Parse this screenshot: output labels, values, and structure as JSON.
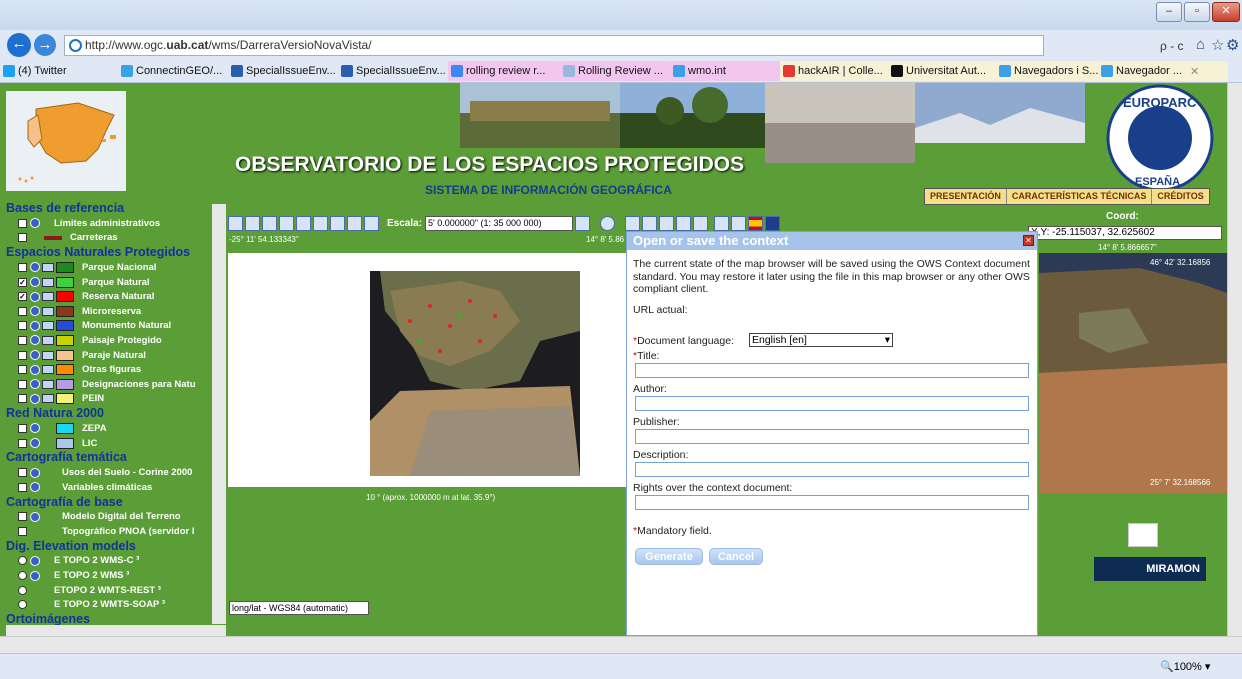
{
  "browser": {
    "url_prefix": "http://www.ogc.",
    "url_domain": "uab.cat",
    "url_path": "/wms/DarreraVersioNovaVista/",
    "search_label": "ρ - c",
    "window_buttons": {
      "minimize": "–",
      "maximize": "▫",
      "close": "✕"
    },
    "nav": {
      "back": "←",
      "forward": "→"
    },
    "tab_close": "✕",
    "favorites": [
      {
        "label": "(4) Twitter",
        "icon_color": "#1da1f2"
      },
      {
        "label": "ConnectinGEO/...",
        "icon_color": "#3aa0e8"
      },
      {
        "label": "SpecialIssueEnv...",
        "icon_color": "#2a5fb0"
      },
      {
        "label": "SpecialIssueEnv...",
        "icon_color": "#2a5fb0"
      },
      {
        "label": "rolling review r...",
        "icon_color": "#4285f4"
      },
      {
        "label": "Rolling Review ...",
        "icon_color": "#9ab7e0"
      },
      {
        "label": "wmo.int",
        "icon_color": "#3aa0e8"
      },
      {
        "label": "hackAIR | Colle...",
        "icon_color": "#e53935"
      },
      {
        "label": "Universitat Aut...",
        "icon_color": "#111111"
      },
      {
        "label": "Navegadors i S...",
        "icon_color": "#3aa0e8"
      },
      {
        "label": "Navegador ...",
        "icon_color": "#3aa0e8"
      }
    ],
    "zoom": "🔍100%  ▾"
  },
  "header": {
    "title": "OBSERVATORIO DE LOS ESPACIOS PROTEGIDOS",
    "subtitle": "SISTEMA DE INFORMACIÓN GEOGRÁFICA",
    "logo_text_top": "EUROPARC",
    "logo_text_bottom": "ESPAÑA",
    "nav": [
      "PRESENTACIÓN",
      "CARACTERÍSTICAS TÉCNICAS",
      "CRÉDITOS"
    ]
  },
  "legend": {
    "sections": [
      {
        "title": "Bases de referencia",
        "items": [
          {
            "label": "Límites administrativos",
            "checked": false,
            "swatch": "",
            "line": ""
          },
          {
            "label": "Carreteras",
            "checked": false,
            "swatch": "",
            "line": "#8b1a1a"
          }
        ]
      },
      {
        "title": "Espacios Naturales Protegidos",
        "items": [
          {
            "label": "Parque Nacional",
            "checked": false,
            "swatch": "#1e8a1e"
          },
          {
            "label": "Parque Natural",
            "checked": true,
            "swatch": "#3fcf3f"
          },
          {
            "label": "Reserva Natural",
            "checked": true,
            "swatch": "#ff0000"
          },
          {
            "label": "Microreserva",
            "checked": false,
            "swatch": "#8a3a1a"
          },
          {
            "label": "Monumento Natural",
            "checked": false,
            "swatch": "#2a4adc"
          },
          {
            "label": "Paisaje Protegido",
            "checked": false,
            "swatch": "#c8d400"
          },
          {
            "label": "Paraje Natural",
            "checked": false,
            "swatch": "#f5c38c"
          },
          {
            "label": "Otras figuras",
            "checked": false,
            "swatch": "#ff8c00"
          },
          {
            "label": "Designaciones para Natu",
            "checked": false,
            "swatch": "#b89be8"
          },
          {
            "label": "PEIN",
            "checked": false,
            "swatch": "#f7f07a"
          }
        ]
      },
      {
        "title": "Red Natura 2000",
        "items": [
          {
            "label": "ZEPA",
            "checked": false,
            "swatch": "#19d6f5"
          },
          {
            "label": "LIC",
            "checked": false,
            "swatch": "#a9c6ee"
          }
        ]
      },
      {
        "title": "Cartografía temática",
        "items": [
          {
            "label": "Usos del Suelo - Corine 2000",
            "checked": false,
            "swatch": ""
          },
          {
            "label": "Variables climáticas",
            "checked": false,
            "swatch": ""
          }
        ]
      },
      {
        "title": "Cartografía de base",
        "items": [
          {
            "label": "Modelo Digital del Terreno",
            "checked": false,
            "swatch": ""
          },
          {
            "label": "Topográfico PNOA (servidor I",
            "checked": false,
            "swatch": ""
          }
        ]
      },
      {
        "title": "Dig. Elevation models",
        "items": [
          {
            "label": "E TOPO 2 WMS-C ³",
            "checked": false,
            "swatch": ""
          },
          {
            "label": "E TOPO 2 WMS ³",
            "checked": false,
            "swatch": ""
          },
          {
            "label": "ETOPO 2 WMTS-REST ³",
            "checked": false,
            "swatch": ""
          },
          {
            "label": "E TOPO 2 WMTS-SOAP ³",
            "checked": false,
            "swatch": ""
          }
        ]
      },
      {
        "title": "Ortoimágenes",
        "items": []
      }
    ]
  },
  "toolbar": {
    "scale_label": "Escala:",
    "scale_value": "5' 0.000000\" (1: 35 000 000)",
    "lang_flags": [
      "es",
      "uk"
    ]
  },
  "map": {
    "top_left_coord": "-25° 11' 54.133343\"",
    "top_mid_coord": "14° 8' 5.86",
    "caption": "10 ° (aprox. 1000000 m at lat. 35.9°)",
    "crs": "long/lat - WGS84 (automatic)"
  },
  "right_panel": {
    "coord_label": "Coord:",
    "coord_value": "X,Y: -25.115037, 32.625602",
    "top_coord": "14° 8' 5.866657\"",
    "right_coord_top": "46° 42' 32.16856",
    "right_coord_bottom": "25° 7' 32.168566",
    "miramon": "MIRAMON"
  },
  "dialog": {
    "title": "Open or save the context",
    "intro": "The current state of the map browser will be saved using the OWS Context document standard. You may restore it later using the file in this map browser or any other OWS compliant client.",
    "url_label": "URL actual:",
    "language_label": "Document language:",
    "language_value": "English [en]",
    "fields": [
      {
        "label": "Title:",
        "required": true
      },
      {
        "label": "Author:",
        "required": false
      },
      {
        "label": "Publisher:",
        "required": false
      },
      {
        "label": "Description:",
        "required": false
      },
      {
        "label": "Rights over the context document:",
        "required": false
      }
    ],
    "mandatory_note": "Mandatory field.",
    "generate": "Generate",
    "cancel": "Cancel"
  }
}
